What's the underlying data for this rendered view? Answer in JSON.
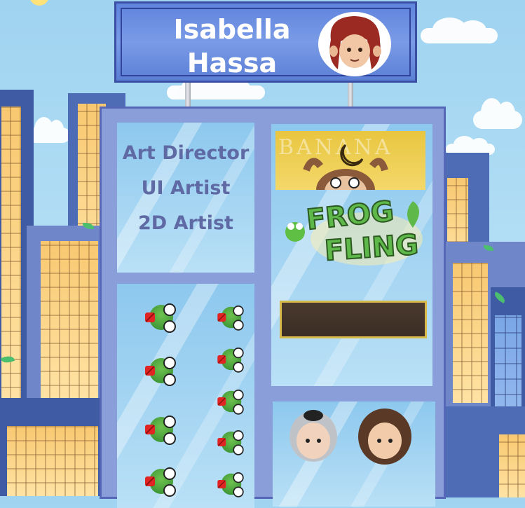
{
  "sign": {
    "name_line1": "Isabella",
    "name_line2": "Hassa"
  },
  "roles": [
    "Art Director",
    "UI Artist",
    "2D Artist"
  ],
  "projects": {
    "banner_word": "BANANA",
    "frog_fling_line1": "FROG",
    "frog_fling_line2": "FLING"
  },
  "colors": {
    "sky": "#a9d8f2",
    "sign_blue": "#6a8fe0",
    "tower_border": "#5567b6",
    "role_text": "#5f69a4",
    "frog_green": "#4fae3c",
    "bow_red": "#e02323"
  }
}
